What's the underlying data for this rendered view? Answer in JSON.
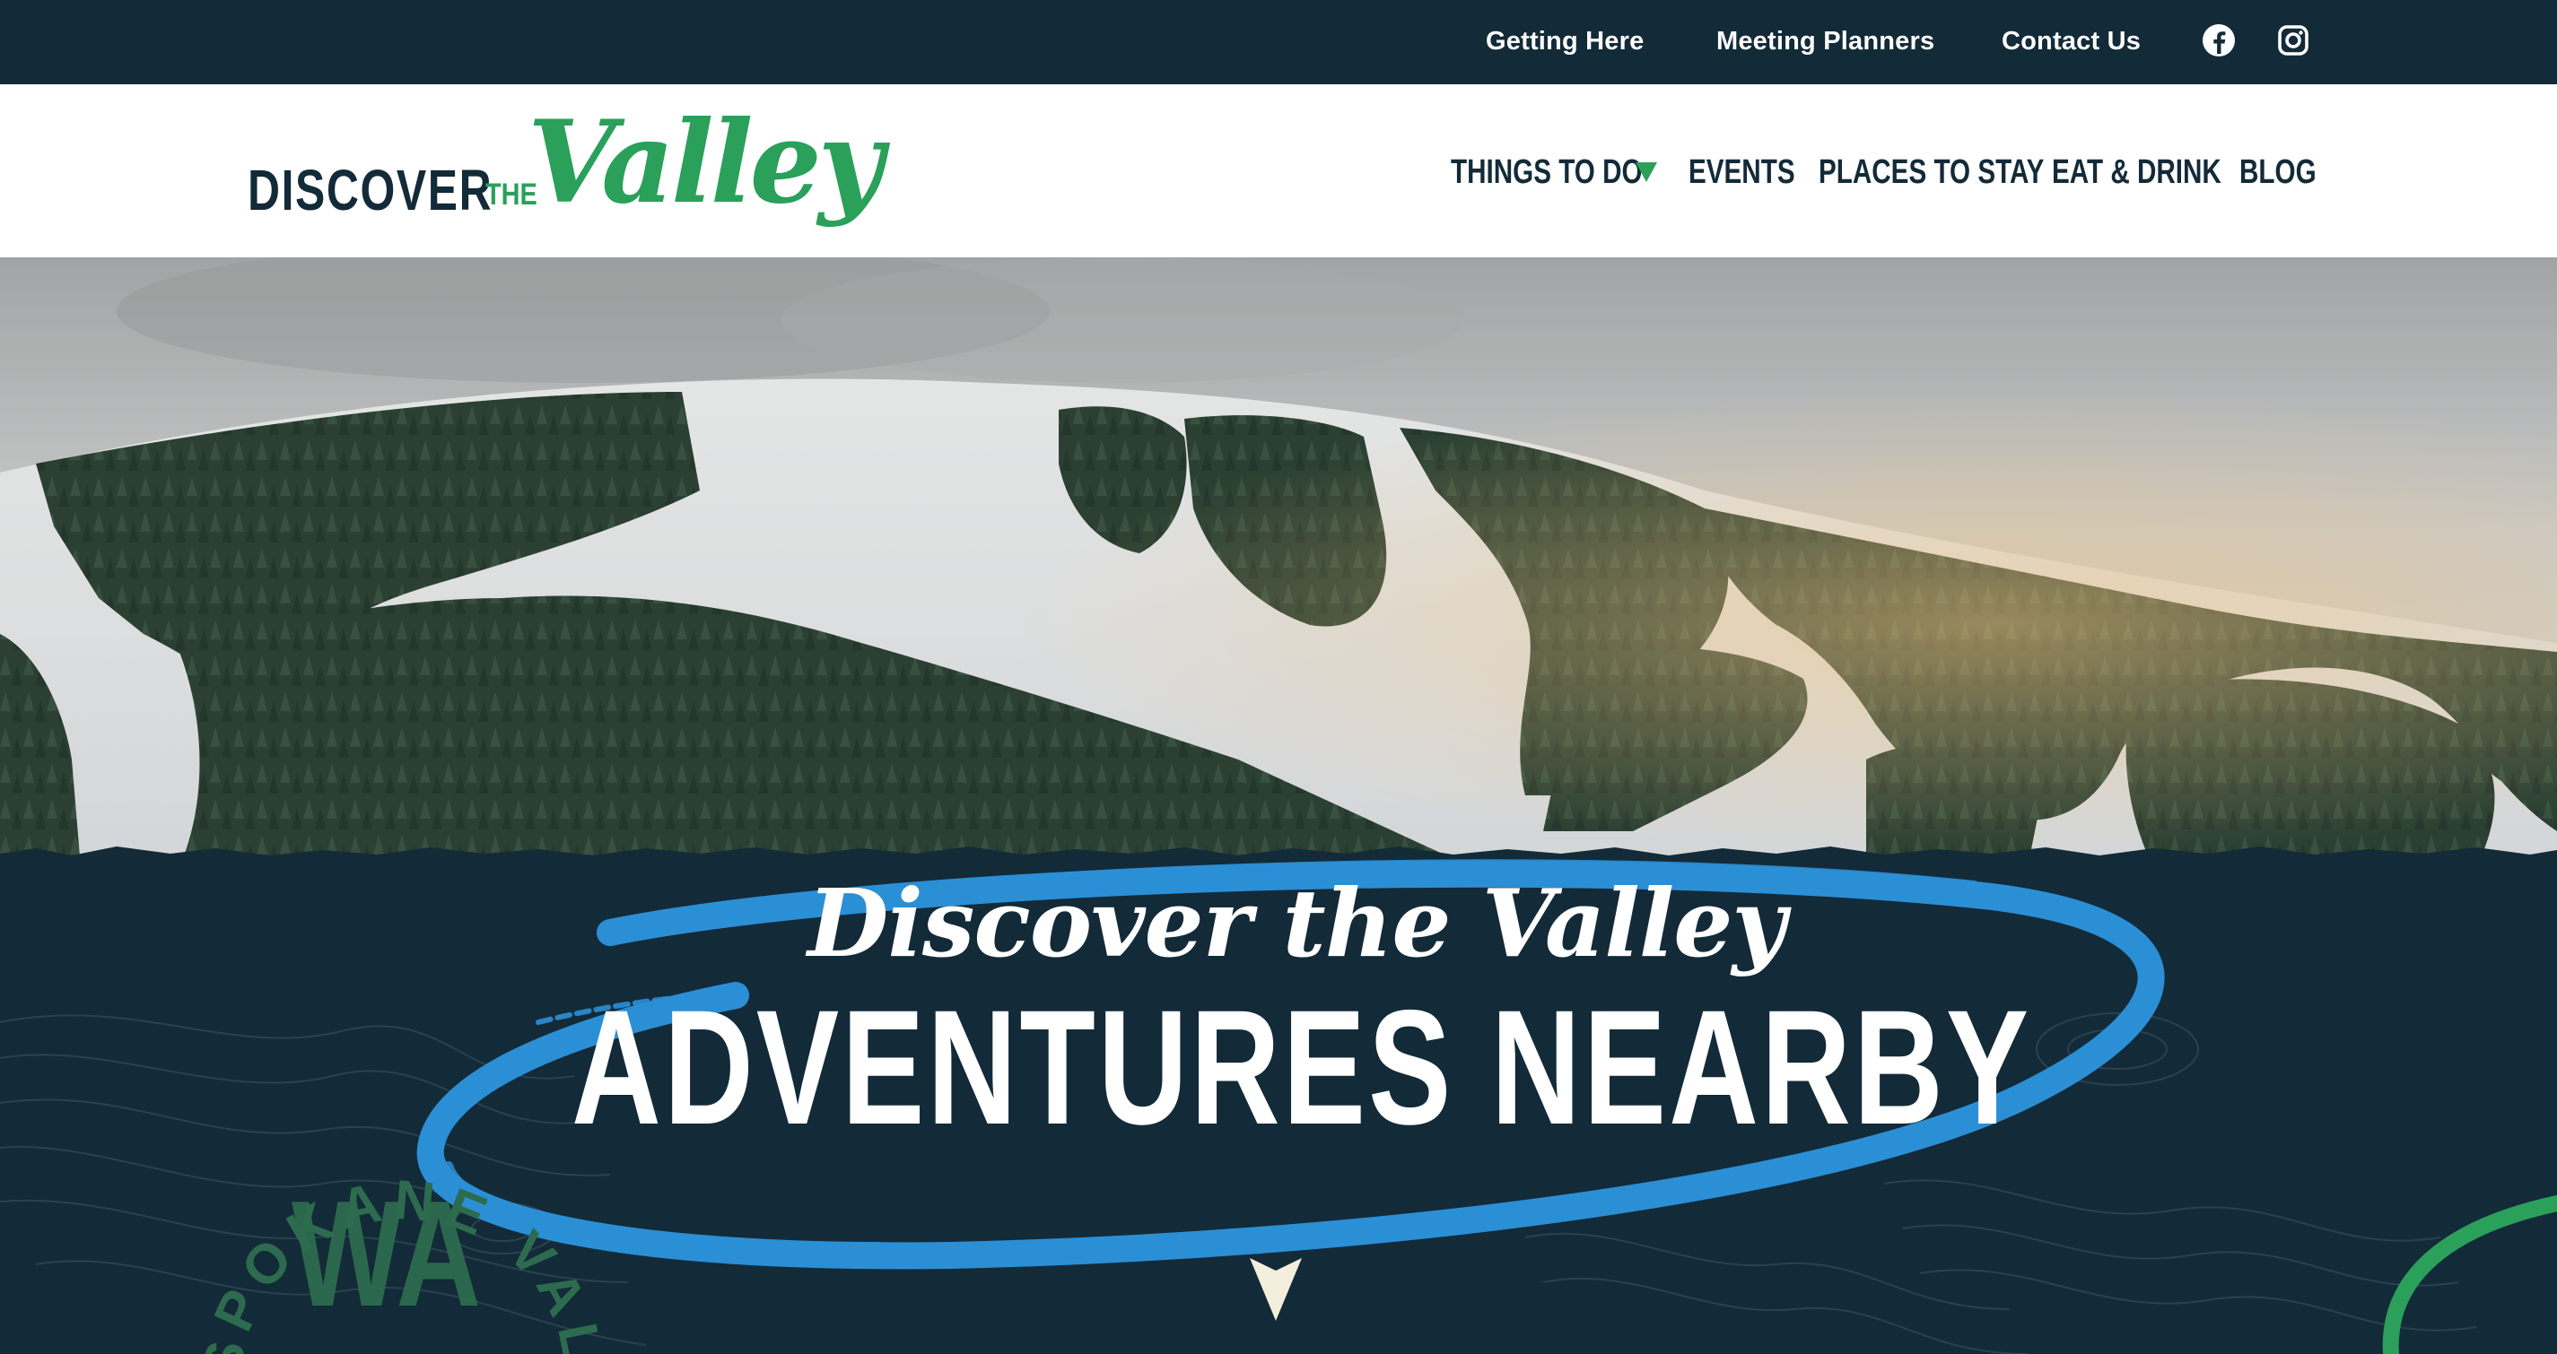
{
  "utility_nav": {
    "links": [
      {
        "label": "Getting Here"
      },
      {
        "label": "Meeting Planners"
      },
      {
        "label": "Contact Us"
      }
    ],
    "social": [
      {
        "icon": "facebook-icon"
      },
      {
        "icon": "instagram-icon"
      }
    ]
  },
  "header": {
    "logo": {
      "word_discover": "DISCOVER",
      "word_the": "THE",
      "word_valley": "Valley"
    },
    "nav": {
      "items": [
        {
          "label": "THINGS TO DO",
          "has_dropdown": true
        },
        {
          "label": "EVENTS"
        },
        {
          "label": "PLACES TO STAY"
        },
        {
          "label": "EAT & DRINK"
        },
        {
          "label": "BLOG"
        }
      ],
      "dropdown_icon": "chevron-down-icon"
    }
  },
  "hero": {
    "script_title": "Discover the Valley",
    "headline": "ADVENTURES NEARBY",
    "scroll_icon": "arrow-down-icon",
    "badge": {
      "ring_text": "SPOKANE VALLEY · SPOKANE VALLEY ·",
      "center_text": "WA"
    }
  },
  "colors": {
    "navy": "#132a38",
    "brand_green": "#2aa05a",
    "brush_blue": "#2b8fd6",
    "badge_green": "#2d6b4e",
    "white": "#ffffff",
    "arrow_cream": "#f3efdc"
  }
}
